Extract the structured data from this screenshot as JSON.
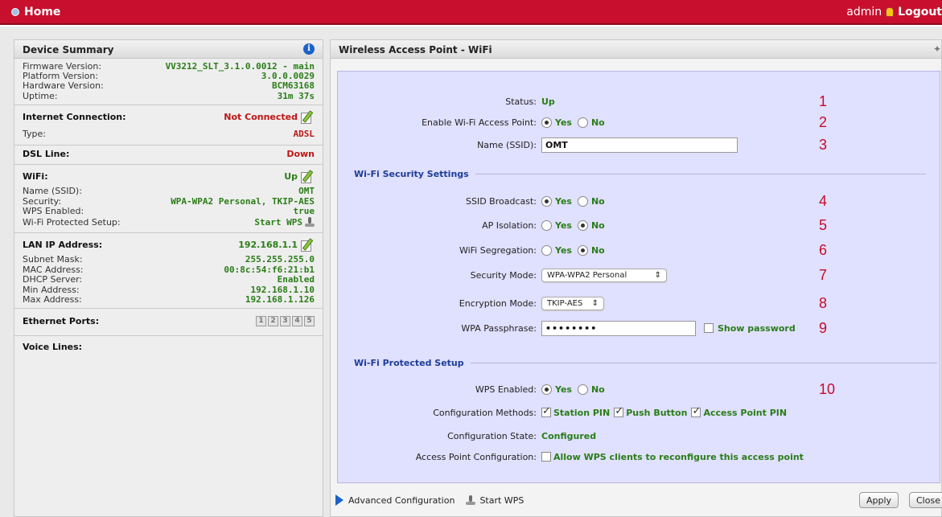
{
  "header": {
    "home_label": "Home",
    "user": "admin",
    "logout_label": "Logout"
  },
  "summary": {
    "title": "Device Summary",
    "firmware": {
      "label": "Firmware Version:",
      "value": "VV3212_SLT_3.1.0.0012 - main"
    },
    "platform": {
      "label": "Platform Version:",
      "value": "3.0.0.0029"
    },
    "hardware": {
      "label": "Hardware Version:",
      "value": "BCM63168"
    },
    "uptime": {
      "label": "Uptime:",
      "value": "31m 37s"
    },
    "internet": {
      "label": "Internet Connection:",
      "value": "Not Connected"
    },
    "type": {
      "label": "Type:",
      "value": "ADSL"
    },
    "dsl": {
      "label": "DSL Line:",
      "value": "Down"
    },
    "wifi": {
      "label": "WiFi:",
      "value": "Up"
    },
    "ssid": {
      "label": "Name (SSID):",
      "value": "OMT"
    },
    "security": {
      "label": "Security:",
      "value": "WPA-WPA2 Personal, TKIP-AES"
    },
    "wps_enabled": {
      "label": "WPS Enabled:",
      "value": "true"
    },
    "wps_setup": {
      "label": "Wi-Fi Protected Setup:",
      "value": "Start WPS"
    },
    "lan": {
      "label": "LAN IP Address:",
      "value": "192.168.1.1"
    },
    "subnet": {
      "label": "Subnet Mask:",
      "value": "255.255.255.0"
    },
    "mac": {
      "label": "MAC Address:",
      "value": "00:8c:54:f6:21:b1"
    },
    "dhcp": {
      "label": "DHCP Server:",
      "value": "Enabled"
    },
    "min": {
      "label": "Min Address:",
      "value": "192.168.1.10"
    },
    "max": {
      "label": "Max Address:",
      "value": "192.168.1.126"
    },
    "ethernet": {
      "label": "Ethernet Ports:",
      "ports": [
        "1",
        "2",
        "3",
        "4",
        "5"
      ]
    },
    "voice": {
      "label": "Voice Lines:"
    }
  },
  "main": {
    "title": "Wireless Access Point - WiFi",
    "yes": "Yes",
    "no": "No",
    "status": {
      "label": "Status:",
      "value": "Up",
      "num": "1"
    },
    "enable": {
      "label": "Enable Wi-Fi Access Point:",
      "num": "2"
    },
    "ssid": {
      "label": "Name (SSID):",
      "value": "OMT",
      "num": "3"
    },
    "sec_title": "Wi-Fi Security Settings",
    "broadcast": {
      "label": "SSID Broadcast:",
      "num": "4"
    },
    "isolation": {
      "label": "AP Isolation:",
      "num": "5"
    },
    "segregation": {
      "label": "WiFi Segregation:",
      "num": "6"
    },
    "mode": {
      "label": "Security Mode:",
      "value": "WPA-WPA2 Personal",
      "num": "7"
    },
    "encryption": {
      "label": "Encryption Mode:",
      "value": "TKIP-AES",
      "num": "8"
    },
    "passphrase": {
      "label": "WPA Passphrase:",
      "value": "••••••••",
      "show": "Show password",
      "num": "9"
    },
    "wps_title": "Wi-Fi Protected Setup",
    "wps": {
      "label": "WPS Enabled:",
      "num": "10"
    },
    "methods": {
      "label": "Configuration Methods:",
      "station": "Station PIN",
      "push": "Push Button",
      "ap": "Access Point PIN"
    },
    "state": {
      "label": "Configuration State:",
      "value": "Configured"
    },
    "apconfig": {
      "label": "Access Point Configuration:",
      "value": "Allow WPS clients to reconfigure this access point"
    }
  },
  "footer": {
    "advanced": "Advanced Configuration",
    "start_wps": "Start WPS",
    "apply": "Apply",
    "close": "Close"
  }
}
